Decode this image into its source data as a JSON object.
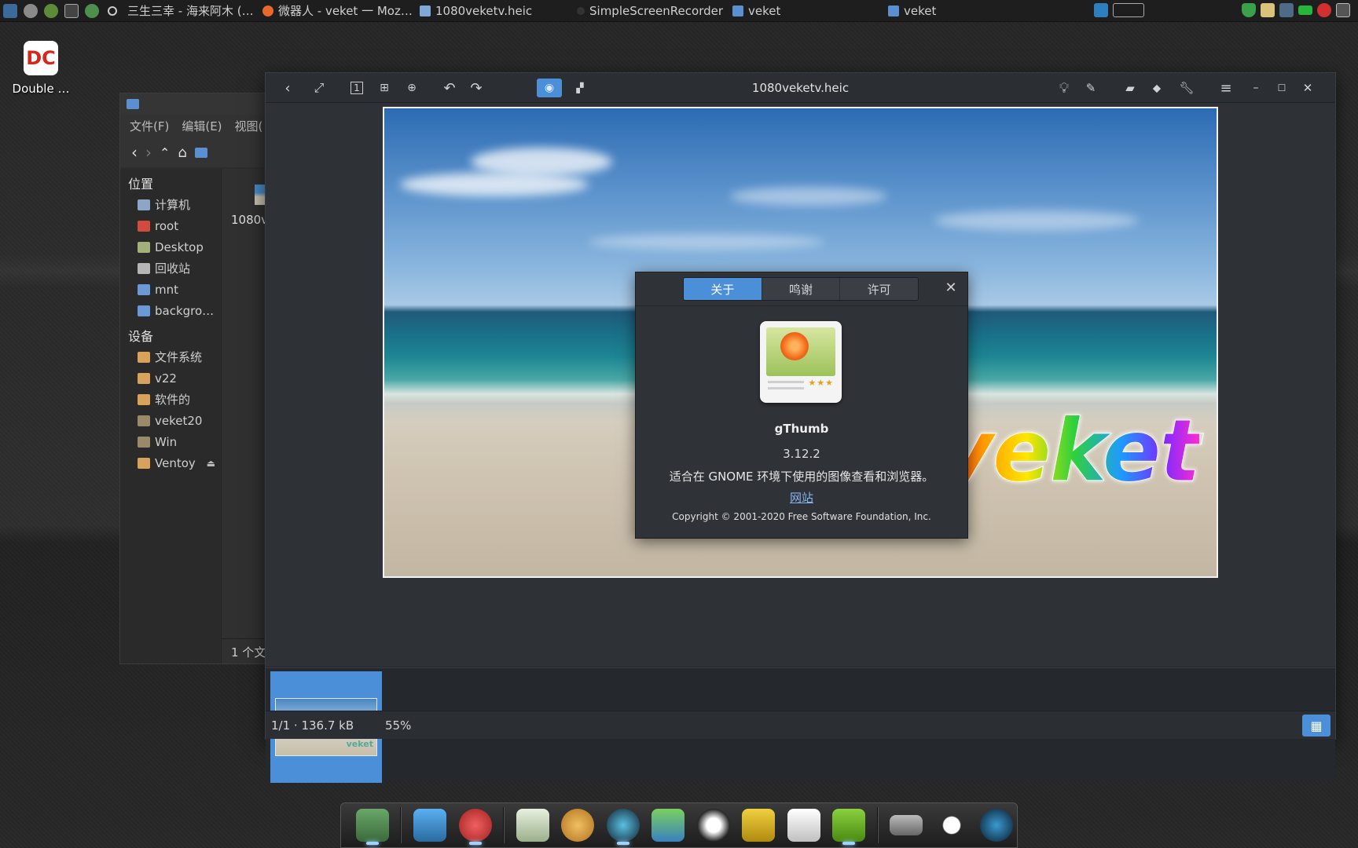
{
  "colors": {
    "accent": "#4a8fd8",
    "viewer_bg": "#25282c",
    "taskbar_bg": "#1e1e1e"
  },
  "taskbar": {
    "launchers": [
      "system-monitor-icon",
      "settings-icon",
      "media-player-icon",
      "terminal-icon",
      "browser-globe-icon",
      "circle-icon"
    ],
    "tasks": [
      {
        "label": "三生三幸 - 海来阿木 (…",
        "icon": "music-icon"
      },
      {
        "label": "微器人 - veket 一 Moz…",
        "icon": "firefox-icon"
      },
      {
        "label": "1080veketv.heic",
        "icon": "image-viewer-icon"
      },
      {
        "label": "SimpleScreenRecorder",
        "icon": "recorder-icon"
      },
      {
        "label": "veket",
        "icon": "folder-icon"
      },
      {
        "label": "veket",
        "icon": "folder-icon"
      }
    ],
    "tray": [
      "network-monitor-icon",
      "window-icon",
      "shield-icon",
      "clipboard-icon",
      "network-icon",
      "battery-icon",
      "record-icon",
      "keyboard-icon"
    ]
  },
  "desktop": {
    "icon_label": "Double …"
  },
  "file_manager": {
    "menu": [
      "文件(F)",
      "编辑(E)",
      "视图("
    ],
    "places_header": "位置",
    "places": [
      "计算机",
      "root",
      "Desktop",
      "回收站",
      "mnt",
      "backgro…"
    ],
    "devices_header": "设备",
    "devices": [
      "文件系统",
      "v22",
      "软件的",
      "veket20",
      "Win",
      "Ventoy"
    ],
    "file_name": "1080v",
    "status": "1 个文"
  },
  "viewer": {
    "title": "1080veketv.heic",
    "status_info": "1/1  ·  136.7 kB",
    "zoom": "55%",
    "photo_text": "veket"
  },
  "about": {
    "tabs": [
      "关于",
      "鸣谢",
      "许可"
    ],
    "app_name": "gThumb",
    "version": "3.12.2",
    "description": "适合在 GNOME 环境下使用的图像查看和浏览器。",
    "website": "网站",
    "copyright": "Copyright © 2001-2020 Free Software Foundation, Inc."
  },
  "dock": {
    "items": [
      "file-manager-icon",
      "display-settings-icon",
      "pet-icon",
      "text-editor-icon",
      "paint-icon",
      "media-icon",
      "network-users-icon",
      "penguin-icon",
      "notes-icon",
      "office-icon",
      "help-icon",
      "drive-icon",
      "brightness-icon",
      "camera-icon"
    ]
  }
}
